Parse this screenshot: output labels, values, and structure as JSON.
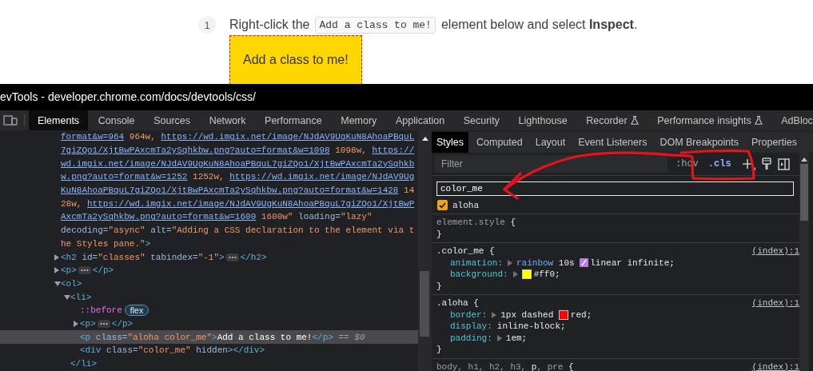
{
  "instruction": {
    "number": "1",
    "before": "Right-click the",
    "code": "Add a class to me!",
    "after": "element below and select **Inspect**."
  },
  "demo_element": {
    "text": "Add a class to me!"
  },
  "devtools": {
    "title": "evTools - developer.chrome.com/docs/devtools/css/",
    "tabs": [
      {
        "label": "Elements",
        "selected": true,
        "experimental": false
      },
      {
        "label": "Console",
        "selected": false,
        "experimental": false
      },
      {
        "label": "Sources",
        "selected": false,
        "experimental": false
      },
      {
        "label": "Network",
        "selected": false,
        "experimental": false
      },
      {
        "label": "Performance",
        "selected": false,
        "experimental": false
      },
      {
        "label": "Memory",
        "selected": false,
        "experimental": false
      },
      {
        "label": "Application",
        "selected": false,
        "experimental": false
      },
      {
        "label": "Security",
        "selected": false,
        "experimental": false
      },
      {
        "label": "Lighthouse",
        "selected": false,
        "experimental": false
      },
      {
        "label": "Recorder",
        "selected": false,
        "experimental": true
      },
      {
        "label": "Performance insights",
        "selected": false,
        "experimental": true
      },
      {
        "label": "AdBloc",
        "selected": false,
        "experimental": false
      }
    ],
    "dom_tree": [
      {
        "selected": false,
        "lines": [
          [
            {
              "kind": "url",
              "text": "format&w=964"
            },
            {
              "kind": "value",
              "text": " 964w, "
            },
            {
              "kind": "url",
              "text": "https://wd.imgix.net/image/NJdAV9UgKuN8AhoaPBquL"
            }
          ],
          [
            {
              "kind": "url",
              "text": "7giZQo1/XjtBwPAxcmTa2ySqhkbw.png?auto=format&w=1098"
            },
            {
              "kind": "value",
              "text": " 1098w, "
            },
            {
              "kind": "url",
              "text": "https://"
            }
          ],
          [
            {
              "kind": "url",
              "text": "wd.imgix.net/image/NJdAV9UgKuN8AhoaPBquL7giZQo1/XjtBwPAxcmTa2ySqhkb"
            }
          ],
          [
            {
              "kind": "url",
              "text": "w.png?auto=format&w=1252"
            },
            {
              "kind": "value",
              "text": " 1252w, "
            },
            {
              "kind": "url",
              "text": "https://wd.imgix.net/image/NJdAV9Ug"
            }
          ],
          [
            {
              "kind": "url",
              "text": "KuN8AhoaPBquL7giZQo1/XjtBwPAxcmTa2ySqhkbw.png?auto=format&w=1428"
            },
            {
              "kind": "value",
              "text": " 14"
            }
          ],
          [
            {
              "kind": "value",
              "text": "28w, "
            },
            {
              "kind": "url",
              "text": "https://wd.imgix.net/image/NJdAV9UgKuN8AhoaPBquL7giZQo1/XjtBwP"
            }
          ],
          [
            {
              "kind": "url",
              "text": "AxcmTa2ySqhkbw.png?auto=format&w=1600"
            },
            {
              "kind": "value",
              "text": " 1600w\""
            },
            {
              "kind": "name",
              "text": " loading="
            },
            {
              "kind": "value",
              "text": "\"lazy\""
            }
          ],
          [
            {
              "kind": "name",
              "text": "decoding="
            },
            {
              "kind": "value",
              "text": "\"async\""
            },
            {
              "kind": "name",
              "text": " alt="
            },
            {
              "kind": "value",
              "text": "\"Adding a CSS declaration to the element via t"
            }
          ],
          [
            {
              "kind": "value",
              "text": "he Styles pane.\""
            },
            {
              "kind": "tag",
              "text": ">"
            }
          ]
        ]
      },
      {
        "selected": false,
        "expanded": false,
        "lines": [
          [
            {
              "kind": "tag",
              "text": "<h2"
            },
            {
              "kind": "name",
              "text": " id="
            },
            {
              "kind": "value",
              "text": "\"classes\""
            },
            {
              "kind": "name",
              "text": " tabindex="
            },
            {
              "kind": "value",
              "text": "\"-1\""
            },
            {
              "kind": "tag",
              "text": ">"
            },
            {
              "kind": "ellipsis"
            },
            {
              "kind": "tag",
              "text": "</h2>"
            }
          ]
        ]
      },
      {
        "selected": false,
        "expanded": false,
        "lines": [
          [
            {
              "kind": "tag",
              "text": "<p>"
            },
            {
              "kind": "ellipsis"
            },
            {
              "kind": "tag",
              "text": "</p>"
            }
          ]
        ]
      },
      {
        "selected": false,
        "expanded": true,
        "lines": [
          [
            {
              "kind": "tag",
              "text": "<ol>"
            }
          ]
        ],
        "children": [
          {
            "selected": false,
            "expanded": true,
            "lines": [
              [
                {
                  "kind": "tag",
                  "text": "<li>"
                }
              ]
            ],
            "closing": [
              [
                {
                  "kind": "tag",
                  "text": "</li>"
                }
              ]
            ],
            "children": [
              {
                "selected": false,
                "lines": [
                  [
                    {
                      "kind": "pseudo",
                      "text": "::before"
                    },
                    {
                      "kind": "badge",
                      "text": "flex"
                    }
                  ]
                ]
              },
              {
                "selected": false,
                "expanded": false,
                "lines": [
                  [
                    {
                      "kind": "tag",
                      "text": "<p>"
                    },
                    {
                      "kind": "ellipsis"
                    },
                    {
                      "kind": "tag",
                      "text": "</p>"
                    }
                  ]
                ]
              },
              {
                "selected": true,
                "lines": [
                  [
                    {
                      "kind": "tag",
                      "text": "<p"
                    },
                    {
                      "kind": "name",
                      "text": " class="
                    },
                    {
                      "kind": "value",
                      "text": "\"aloha color_me\""
                    },
                    {
                      "kind": "tag",
                      "text": ">"
                    },
                    {
                      "kind": "text",
                      "text": "Add a class to me!"
                    },
                    {
                      "kind": "tag",
                      "text": "</p>"
                    },
                    {
                      "kind": "marker",
                      "text": " == $0"
                    }
                  ]
                ]
              },
              {
                "selected": false,
                "lines": [
                  [
                    {
                      "kind": "tag",
                      "text": "<div"
                    },
                    {
                      "kind": "name",
                      "text": " class="
                    },
                    {
                      "kind": "value",
                      "text": "\"color_me\""
                    },
                    {
                      "kind": "name",
                      "text": " hidden"
                    },
                    {
                      "kind": "tag",
                      "text": "></div>"
                    }
                  ]
                ]
              }
            ]
          }
        ]
      }
    ],
    "styles_tabs": [
      {
        "label": "Styles",
        "selected": true
      },
      {
        "label": "Computed",
        "selected": false
      },
      {
        "label": "Layout",
        "selected": false
      },
      {
        "label": "Event Listeners",
        "selected": false
      },
      {
        "label": "DOM Breakpoints",
        "selected": false
      },
      {
        "label": "Properties",
        "selected": false
      }
    ],
    "filter": {
      "placeholder": "Filter"
    },
    "toolbar": {
      "hover": ":hov",
      "classes": ".cls"
    },
    "class_input": {
      "value": "color_me"
    },
    "classes": [
      {
        "name": "aloha",
        "checked": true
      }
    ],
    "rules": [
      {
        "selector": [
          {
            "text": "element.style",
            "matched": false
          }
        ],
        "open": " {",
        "close": "}"
      },
      {
        "selector": [
          {
            "text": ".color_me",
            "matched": true
          }
        ],
        "open": " {",
        "close": "}",
        "source": "(index):1",
        "declarations": [
          {
            "property": "animation:",
            "expandable": true,
            "value": [
              {
                "kind": "link",
                "text": "rainbow"
              },
              {
                "kind": "text",
                "text": " 10s "
              },
              {
                "kind": "easing"
              },
              {
                "kind": "text",
                "text": "linear infinite;"
              }
            ]
          },
          {
            "property": "background:",
            "expandable": true,
            "value": [
              {
                "kind": "swatch",
                "color": "#ffff00"
              },
              {
                "kind": "text",
                "text": "#ff0;"
              }
            ]
          }
        ]
      },
      {
        "selector": [
          {
            "text": ".aloha",
            "matched": true
          }
        ],
        "open": " {",
        "close": "}",
        "source": "(index):1",
        "declarations": [
          {
            "property": "border:",
            "expandable": true,
            "value": [
              {
                "kind": "text",
                "text": "1px dashed "
              },
              {
                "kind": "swatch",
                "color": "#ff0000"
              },
              {
                "kind": "text",
                "text": "red;"
              }
            ]
          },
          {
            "property": "display:",
            "expandable": false,
            "value": [
              {
                "kind": "text",
                "text": "inline-block;"
              }
            ]
          },
          {
            "property": "padding:",
            "expandable": true,
            "value": [
              {
                "kind": "text",
                "text": "1em;"
              }
            ]
          }
        ]
      },
      {
        "selector": [
          {
            "text": "body, h1, h2, h3, ",
            "matched": false
          },
          {
            "text": "p",
            "matched": true
          },
          {
            "text": ", pre",
            "matched": false
          }
        ],
        "open": " {",
        "source": "(index):1"
      }
    ]
  }
}
